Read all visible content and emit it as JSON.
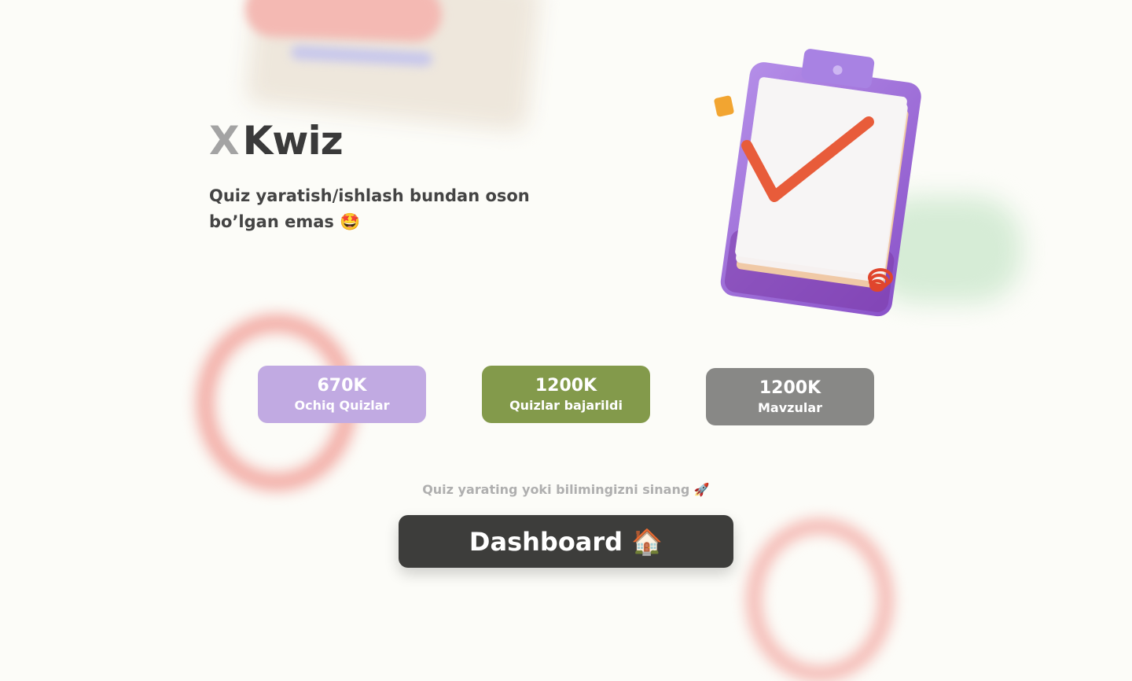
{
  "brand": {
    "prefix": "X",
    "name": "Kwiz"
  },
  "hero": {
    "tagline": "Quiz yaratish/ishlash bundan oson bo’lgan emas 🤩"
  },
  "stats": [
    {
      "value": "670K",
      "label": "Ochiq Quizlar",
      "color": "#c1aae2"
    },
    {
      "value": "1200K",
      "label": "Quizlar bajarildi",
      "color": "#839a4b"
    },
    {
      "value": "1200K",
      "label": "Mavzular",
      "color": "#888886"
    }
  ],
  "cta": {
    "hint": "Quiz yarating yoki bilimingizni sinang 🚀",
    "button_label": "Dashboard 🏠"
  },
  "icons": {
    "illustration": "clipboard-checkmark-illustration"
  }
}
